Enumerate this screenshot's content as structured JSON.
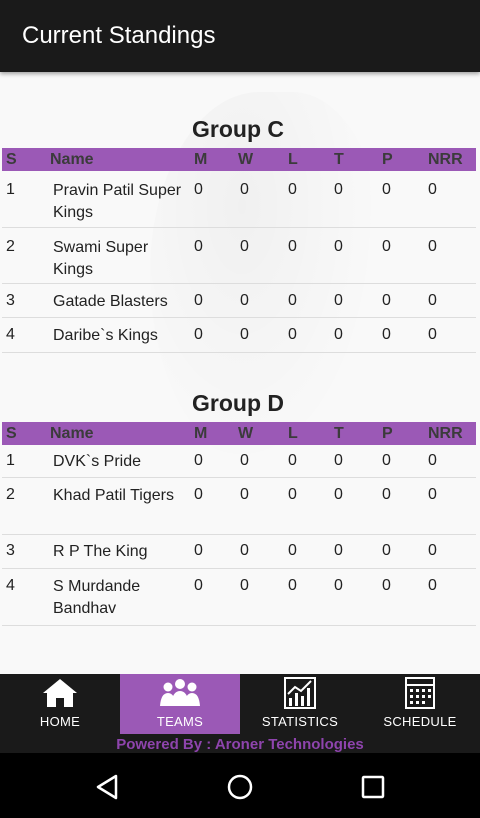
{
  "appbar": {
    "title": "Current Standings"
  },
  "columns": {
    "s": "S",
    "name": "Name",
    "m": "M",
    "w": "W",
    "l": "L",
    "t": "T",
    "p": "P",
    "nrr": "NRR"
  },
  "groups": [
    {
      "title": "Group C",
      "teams": [
        {
          "s": "1",
          "name": "Pravin Patil Super Kings",
          "m": "0",
          "w": "0",
          "l": "0",
          "t": "0",
          "p": "0",
          "nrr": "0"
        },
        {
          "s": "2",
          "name": "Swami Super Kings",
          "m": "0",
          "w": "0",
          "l": "0",
          "t": "0",
          "p": "0",
          "nrr": "0"
        },
        {
          "s": "3",
          "name": "Gatade Blasters",
          "m": "0",
          "w": "0",
          "l": "0",
          "t": "0",
          "p": "0",
          "nrr": "0"
        },
        {
          "s": "4",
          "name": "Daribe`s Kings",
          "m": "0",
          "w": "0",
          "l": "0",
          "t": "0",
          "p": "0",
          "nrr": "0"
        }
      ]
    },
    {
      "title": "Group D",
      "teams": [
        {
          "s": "1",
          "name": "DVK`s Pride",
          "m": "0",
          "w": "0",
          "l": "0",
          "t": "0",
          "p": "0",
          "nrr": "0"
        },
        {
          "s": "2",
          "name": "Khad Patil Tigers",
          "m": "0",
          "w": "0",
          "l": "0",
          "t": "0",
          "p": "0",
          "nrr": "0"
        },
        {
          "s": "3",
          "name": "R P The King",
          "m": "0",
          "w": "0",
          "l": "0",
          "t": "0",
          "p": "0",
          "nrr": "0"
        },
        {
          "s": "4",
          "name": "S Murdande Bandhav",
          "m": "0",
          "w": "0",
          "l": "0",
          "t": "0",
          "p": "0",
          "nrr": "0"
        }
      ]
    }
  ],
  "tabs": [
    {
      "label": "HOME",
      "icon": "home-icon",
      "active": false
    },
    {
      "label": "TEAMS",
      "icon": "teams-icon",
      "active": true
    },
    {
      "label": "STATISTICS",
      "icon": "statistics-icon",
      "active": false
    },
    {
      "label": "SCHEDULE",
      "icon": "schedule-icon",
      "active": false
    }
  ],
  "footer": {
    "powered": "Powered By : Aroner Technologies"
  },
  "colors": {
    "accent": "#9b59b6",
    "appbar": "#1a1a1a",
    "powered": "#8e44ad"
  }
}
